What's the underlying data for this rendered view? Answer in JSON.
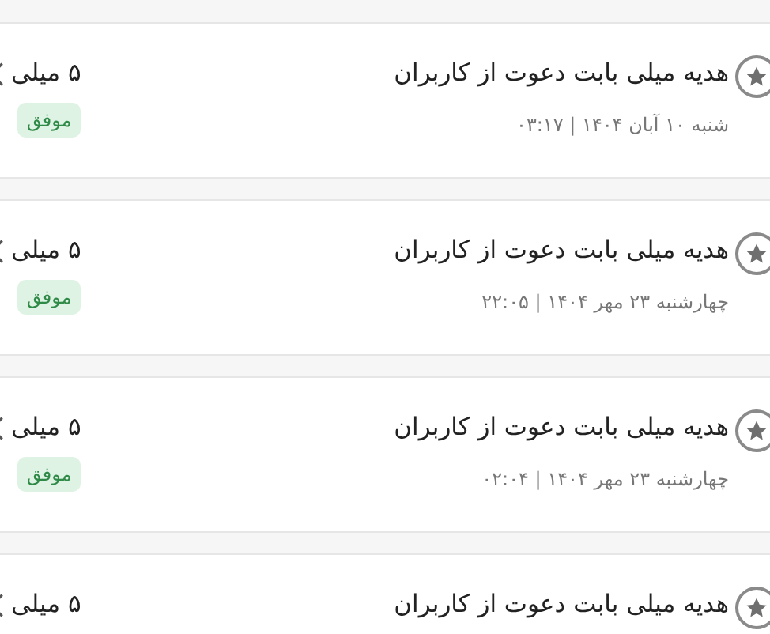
{
  "transactions": [
    {
      "title": "هدیه میلی بابت دعوت از کاربران",
      "date": "شنبه ۱۰ آبان ۱۴۰۴ | ۰۳:۱۷",
      "amount": "۵ میلی",
      "status": "موفق"
    },
    {
      "title": "هدیه میلی بابت دعوت از کاربران",
      "date": "چهارشنبه ۲۳ مهر ۱۴۰۴ | ۲۲:۰۵",
      "amount": "۵ میلی",
      "status": "موفق"
    },
    {
      "title": "هدیه میلی بابت دعوت از کاربران",
      "date": "چهارشنبه ۲۳ مهر ۱۴۰۴ | ۰۲:۰۴",
      "amount": "۵ میلی",
      "status": "موفق"
    },
    {
      "title": "هدیه میلی بابت دعوت از کاربران",
      "amount": "۵ میلی"
    }
  ]
}
